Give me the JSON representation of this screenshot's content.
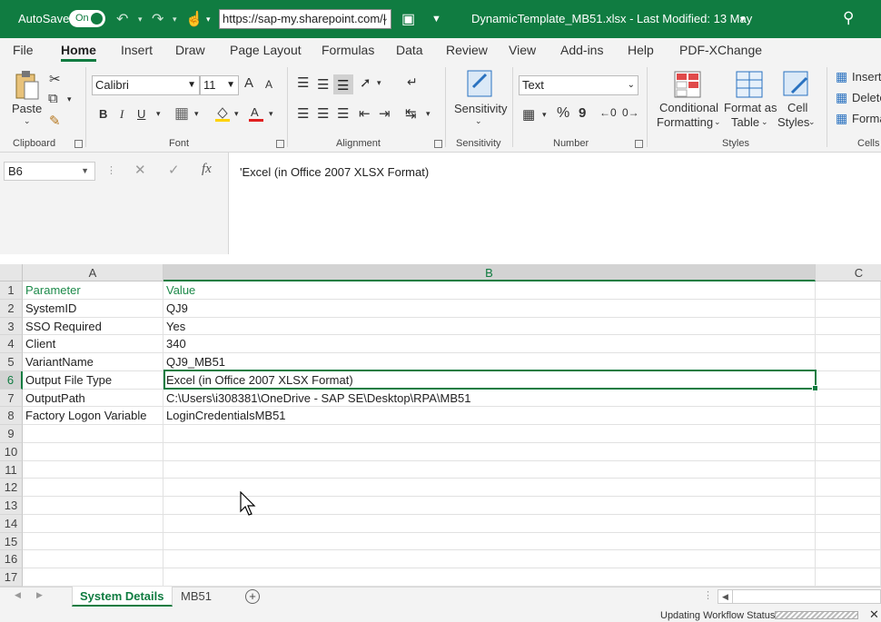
{
  "titlebar": {
    "autosave_label": "AutoSave",
    "autosave_state": "On",
    "url": "https://sap-my.sharepoint.com/|",
    "file_title": "DynamicTemplate_MB51.xlsx  -  Last Modified: 13 May",
    "accent": "#107c41"
  },
  "menu": {
    "tabs": [
      "File",
      "Home",
      "Insert",
      "Draw",
      "Page Layout",
      "Formulas",
      "Data",
      "Review",
      "View",
      "Add-ins",
      "Help",
      "PDF-XChange"
    ]
  },
  "ribbon": {
    "clipboard": {
      "paste": "Paste",
      "label": "Clipboard"
    },
    "font": {
      "name": "Calibri",
      "size": "11",
      "bold": "B",
      "italic": "I",
      "underline": "U",
      "grow": "A",
      "shrink": "A",
      "label": "Font"
    },
    "alignment": {
      "label": "Alignment"
    },
    "sensitivity": {
      "button": "Sensitivity",
      "label": "Sensitivity"
    },
    "number": {
      "format": "Text",
      "percent": "%",
      "comma": "9",
      "label": "Number"
    },
    "styles": {
      "conditional": "Conditional",
      "conditional2": "Formatting",
      "format_as": "Format as",
      "format_as2": "Table",
      "cell": "Cell",
      "cell2": "Styles",
      "label": "Styles"
    },
    "cells": {
      "insert": "Insert",
      "delete": "Delete",
      "format": "Format",
      "label": "Cells"
    }
  },
  "formula_bar": {
    "name_box": "B6",
    "content": "'Excel (in Office 2007 XLSX Format)"
  },
  "grid": {
    "columns": [
      "A",
      "B",
      "C"
    ],
    "active_cell": "B6",
    "rows": [
      {
        "n": "1",
        "a": "Parameter",
        "b": "Value"
      },
      {
        "n": "2",
        "a": "SystemID",
        "b": "QJ9"
      },
      {
        "n": "3",
        "a": "SSO Required",
        "b": "Yes"
      },
      {
        "n": "4",
        "a": "Client",
        "b": "340"
      },
      {
        "n": "5",
        "a": "VariantName",
        "b": "QJ9_MB51"
      },
      {
        "n": "6",
        "a": "Output File Type",
        "b": "Excel (in Office 2007 XLSX Format)"
      },
      {
        "n": "7",
        "a": "OutputPath",
        "b": "C:\\Users\\i308381\\OneDrive - SAP SE\\Desktop\\RPA\\MB51"
      },
      {
        "n": "8",
        "a": "Factory Logon Variable",
        "b": "LoginCredentialsMB51"
      },
      {
        "n": "9",
        "a": "",
        "b": ""
      },
      {
        "n": "10",
        "a": "",
        "b": ""
      },
      {
        "n": "11",
        "a": "",
        "b": ""
      },
      {
        "n": "12",
        "a": "",
        "b": ""
      },
      {
        "n": "13",
        "a": "",
        "b": ""
      },
      {
        "n": "14",
        "a": "",
        "b": ""
      },
      {
        "n": "15",
        "a": "",
        "b": ""
      },
      {
        "n": "16",
        "a": "",
        "b": ""
      },
      {
        "n": "17",
        "a": "",
        "b": ""
      }
    ]
  },
  "sheets": {
    "tabs": [
      "System Details",
      "MB51"
    ],
    "active": "System Details"
  },
  "status": {
    "text": "Updating Workflow Status"
  }
}
